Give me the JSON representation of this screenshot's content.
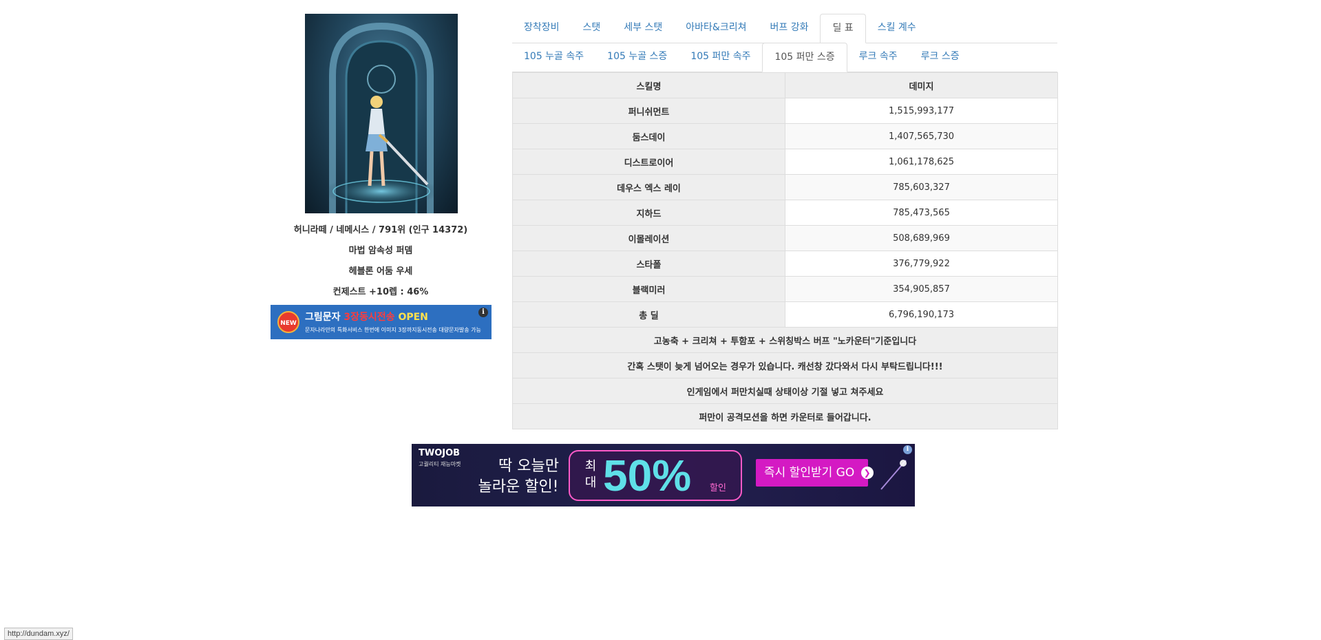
{
  "character": {
    "summary": "허니라떼 / 네메시스 / 791위 (인구 14372)",
    "build": "마법 암속성 퍼뎀",
    "weapon": "헤블론 어둠 우세",
    "contest": "컨제스트 +10렙 : 46%"
  },
  "ad_small": {
    "badge": "NEW",
    "headline_prefix": "그림문자",
    "headline_highlight": "3장동시전송",
    "headline_suffix": "OPEN",
    "subtext": "문자나라만의 특화서비스 한번에 이미지 3장까지동시전송 대량문자발송 가능",
    "info_icon": "i"
  },
  "tabs_row1": [
    {
      "label": "장착장비",
      "active": false
    },
    {
      "label": "스탯",
      "active": false
    },
    {
      "label": "세부 스탯",
      "active": false
    },
    {
      "label": "아바타&크리쳐",
      "active": false
    },
    {
      "label": "버프 강화",
      "active": false
    },
    {
      "label": "딜 표",
      "active": true
    },
    {
      "label": "스킬 계수",
      "active": false
    }
  ],
  "tabs_row2": [
    {
      "label": "105 누골 속주",
      "active": false
    },
    {
      "label": "105 누골 스증",
      "active": false
    },
    {
      "label": "105 퍼만 속주",
      "active": false
    },
    {
      "label": "105 퍼만 스증",
      "active": true
    },
    {
      "label": "루크 속주",
      "active": false
    },
    {
      "label": "루크 스증",
      "active": false
    }
  ],
  "damage_table": {
    "headers": {
      "name": "스킬명",
      "value": "데미지"
    },
    "rows": [
      {
        "name": "퍼니쉬먼트",
        "value": "1,515,993,177"
      },
      {
        "name": "둠스데이",
        "value": "1,407,565,730"
      },
      {
        "name": "디스트로이어",
        "value": "1,061,178,625"
      },
      {
        "name": "데우스 엑스 레이",
        "value": "785,603,327"
      },
      {
        "name": "지하드",
        "value": "785,473,565"
      },
      {
        "name": "이몰레이션",
        "value": "508,689,969"
      },
      {
        "name": "스타폴",
        "value": "376,779,922"
      },
      {
        "name": "블랙미러",
        "value": "354,905,857"
      },
      {
        "name": "총 딜",
        "value": "6,796,190,173"
      }
    ],
    "notes": [
      "고농축 + 크리쳐 + 투함포 + 스위칭박스 버프 \"노카운터\"기준입니다",
      "간혹 스탯이 늦게 넘어오는 경우가 있습니다. 캐선창 갔다와서 다시 부탁드립니다!!!",
      "인게임에서 퍼만치실때 상태이상 기절 넣고 쳐주세요",
      "퍼만이 공격모션을 하면 카운터로 들어갑니다."
    ]
  },
  "ad_big": {
    "brand": "TWOJOB",
    "brand_sub": "고퀄리티 재능마켓",
    "headline_line1": "딱 오늘만",
    "headline_line2": "놀라운 할인!",
    "percent_prefix": "최대",
    "percent": "50%",
    "percent_suffix": "할인",
    "cta": "즉시 할인받기 GO",
    "info_icon": "i"
  },
  "status_bar": {
    "url": "http://dundam.xyz/"
  },
  "colors": {
    "link": "#337ab7",
    "table_header_bg": "#eeeeee",
    "border": "#dddddd"
  }
}
